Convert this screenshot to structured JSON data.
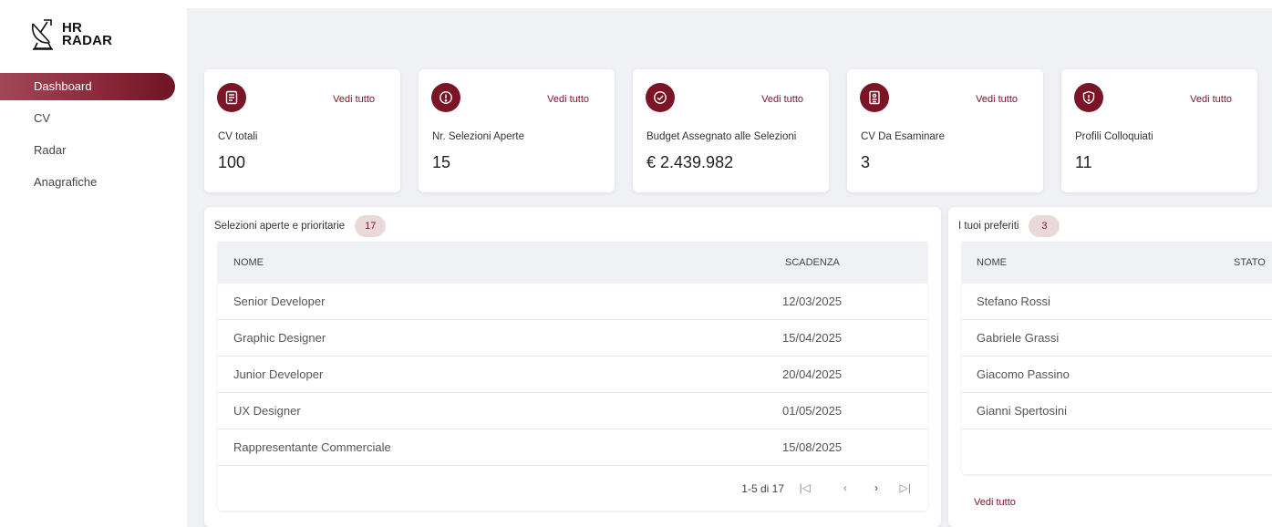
{
  "app": {
    "logo_line1": "HR",
    "logo_line2": "RADAR"
  },
  "sidebar": {
    "items": [
      {
        "label": "Dashboard",
        "active": true
      },
      {
        "label": "CV"
      },
      {
        "label": "Radar"
      },
      {
        "label": "Anagrafiche"
      }
    ]
  },
  "stats": [
    {
      "icon": "document-icon",
      "label": "CV totali",
      "value": "100",
      "link": "Vedi tutto"
    },
    {
      "icon": "alert-circle-icon",
      "label": "Nr. Selezioni Aperte",
      "value": "15",
      "link": "Vedi tutto"
    },
    {
      "icon": "check-circle-icon",
      "label": "Budget Assegnato alle Selezioni",
      "value": "€ 2.439.982",
      "link": "Vedi tutto"
    },
    {
      "icon": "id-badge-icon",
      "label": "CV Da Esaminare",
      "value": "3",
      "link": "Vedi tutto"
    },
    {
      "icon": "shield-icon",
      "label": "Profili Colloquiati",
      "value": "11",
      "link": "Vedi tutto"
    }
  ],
  "selections": {
    "title": "Selezioni aperte e prioritarie",
    "count": "17",
    "columns": {
      "name": "NOME",
      "deadline": "SCADENZA"
    },
    "rows": [
      {
        "name": "Senior Developer",
        "deadline": "12/03/2025"
      },
      {
        "name": "Graphic Designer",
        "deadline": "15/04/2025"
      },
      {
        "name": "Junior Developer",
        "deadline": "20/04/2025"
      },
      {
        "name": "UX Designer",
        "deadline": "01/05/2025"
      },
      {
        "name": "Rappresentante Commerciale",
        "deadline": "15/08/2025"
      }
    ],
    "pagination": "1-5 di 17"
  },
  "favorites": {
    "title": "I tuoi preferiti",
    "count": "3",
    "columns": {
      "name": "NOME",
      "status": "STATO"
    },
    "rows": [
      {
        "name": "Stefano Rossi"
      },
      {
        "name": "Gabriele Grassi"
      },
      {
        "name": "Giacomo Passino"
      },
      {
        "name": "Gianni Spertosini"
      }
    ],
    "link": "Vedi tutto"
  },
  "colors": {
    "accent": "#7a1426",
    "badge_bg": "#ead8db",
    "background": "#f0f1f4"
  }
}
